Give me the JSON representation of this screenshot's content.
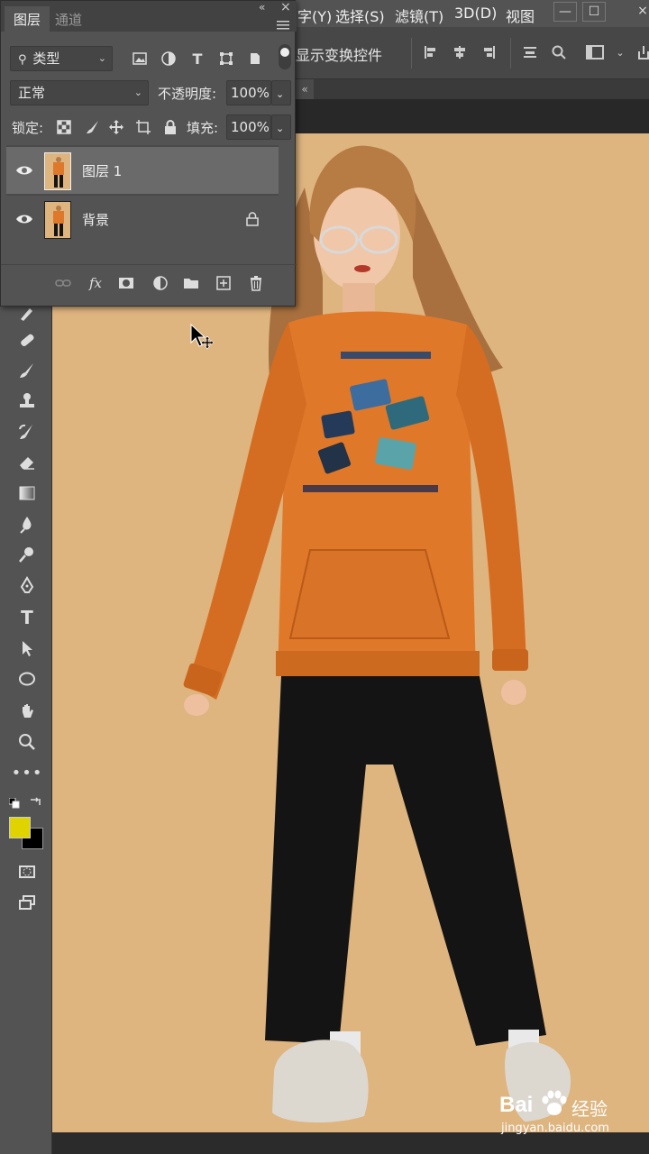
{
  "menu": {
    "partial_item": "字(Y)",
    "items": [
      "选择(S)",
      "滤镜(T)",
      "3D(D)",
      "视图"
    ]
  },
  "options_bar": {
    "show_transform_label": "显示变换控件"
  },
  "layers_panel": {
    "tabs": [
      "图层",
      "通道"
    ],
    "filter_kind": "类型",
    "blend_mode": "正常",
    "opacity_label": "不透明度:",
    "opacity_value": "100%",
    "lock_label": "锁定:",
    "fill_label": "填充:",
    "fill_value": "100%",
    "layers": [
      {
        "name": "图层 1",
        "selected": true,
        "locked": false
      },
      {
        "name": "背景",
        "selected": false,
        "locked": true
      }
    ]
  },
  "colors": {
    "foreground": "#e0d400",
    "background": "#000000",
    "canvas_bg": "#deb47f",
    "shirt": "#e0782a",
    "pants": "#141414"
  },
  "tools": [
    "brush-tool",
    "healing-brush-tool",
    "paint-brush-tool",
    "clone-stamp-tool",
    "history-brush-tool",
    "eraser-tool",
    "gradient-tool",
    "blur-tool",
    "dodge-tool",
    "pen-tool",
    "type-tool",
    "path-selection-tool",
    "ellipse-tool",
    "hand-tool",
    "zoom-tool",
    "more-tools"
  ],
  "watermark": {
    "brand": "Bai",
    "brand_cn": "经验",
    "url": "jingyan.baidu.com"
  }
}
